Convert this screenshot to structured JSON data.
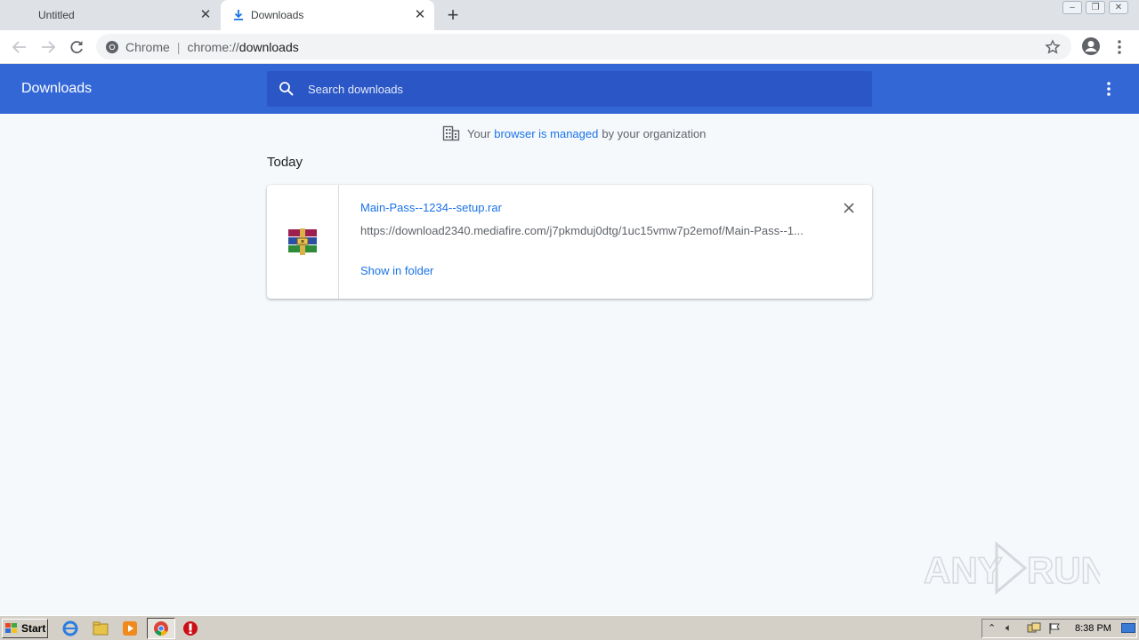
{
  "browser": {
    "tabs": [
      {
        "title": "Untitled",
        "active": false
      },
      {
        "title": "Downloads",
        "active": true
      }
    ],
    "omnibox": {
      "site_label": "Chrome",
      "separator": "|",
      "scheme": "chrome://",
      "host": "downloads"
    }
  },
  "downloads_page": {
    "title": "Downloads",
    "search_placeholder": "Search downloads",
    "managed_notice": {
      "prefix": "Your",
      "link": "browser is managed",
      "suffix": "by your organization"
    },
    "section_label": "Today",
    "items": [
      {
        "file_name": "Main-Pass--1234--setup.rar",
        "url": "https://download2340.mediafire.com/j7pkmduj0dtg/1uc15vmw7p2emof/Main-Pass--1...",
        "action": "Show in folder",
        "icon": "winrar-archive-icon"
      }
    ]
  },
  "watermark": {
    "text": "ANY RUN"
  },
  "taskbar": {
    "start_label": "Start",
    "pinned": [
      "internet-explorer-icon",
      "explorer-folder-icon",
      "media-player-icon",
      "chrome-icon",
      "opera-icon"
    ],
    "clock": "8:38 PM"
  },
  "colors": {
    "header_blue": "#3367d6",
    "search_blue": "#2a56c6",
    "link_blue": "#1a73e8",
    "page_bg": "#f6f9fc"
  }
}
